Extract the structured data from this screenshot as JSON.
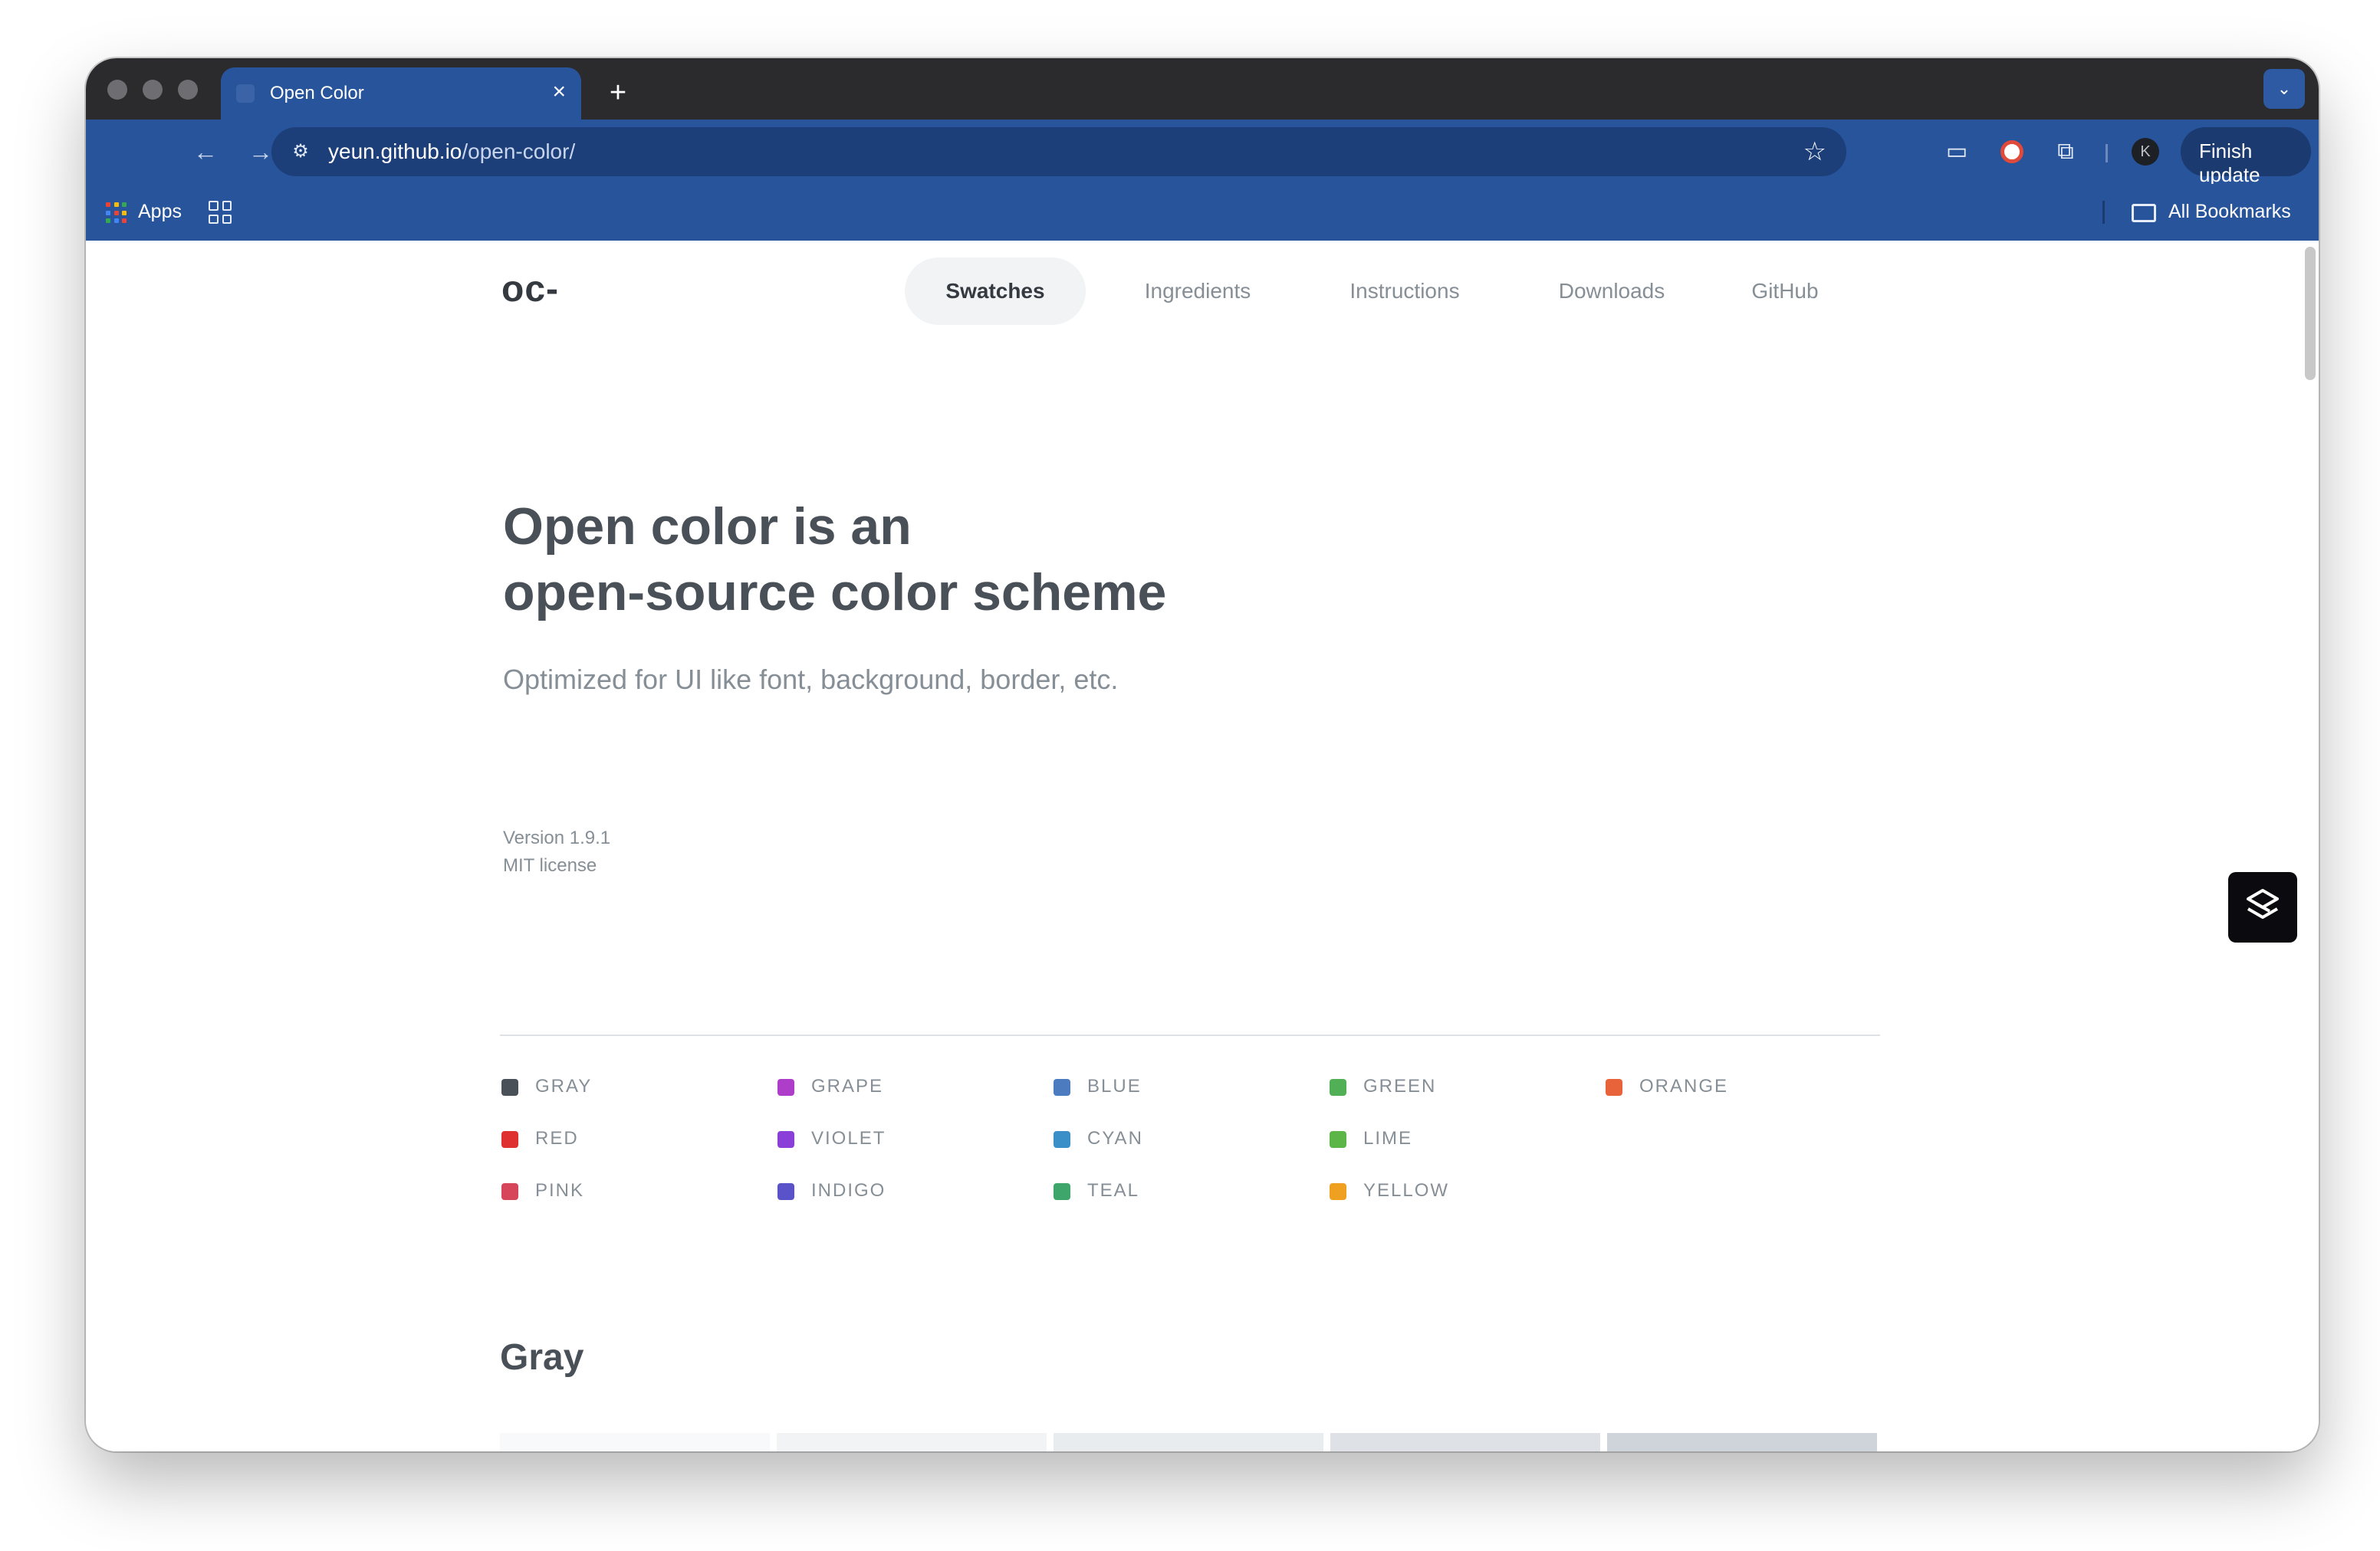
{
  "browser": {
    "tab_title": "Open Color",
    "url_domain": "yeun.github.io",
    "url_path": "/open-color/",
    "finish_update": "Finish update",
    "bookmarks_apps": "Apps",
    "all_bookmarks": "All Bookmarks",
    "profile_initial": "K"
  },
  "site": {
    "logo": "oc-",
    "nav": [
      "Swatches",
      "Ingredients",
      "Instructions",
      "Downloads",
      "GitHub"
    ],
    "active_nav": "Swatches"
  },
  "hero": {
    "title_line1": "Open color is an",
    "title_line2": "open-source color scheme",
    "subtitle": "Optimized for UI like font, background, border, etc.",
    "version": "Version 1.9.1",
    "license": "MIT license"
  },
  "legend": [
    {
      "label": "GRAY",
      "color": "#495057"
    },
    {
      "label": "GRAPE",
      "color": "#ae3ec9"
    },
    {
      "label": "BLUE",
      "color": "#4c7bc0"
    },
    {
      "label": "GREEN",
      "color": "#51b055"
    },
    {
      "label": "ORANGE",
      "color": "#e8633a"
    },
    {
      "label": "RED",
      "color": "#e03131"
    },
    {
      "label": "VIOLET",
      "color": "#8b3fd9"
    },
    {
      "label": "CYAN",
      "color": "#3b8fc9"
    },
    {
      "label": "LIME",
      "color": "#5cb547"
    },
    {
      "label": "PINK",
      "color": "#d6455a"
    },
    {
      "label": "INDIGO",
      "color": "#5a52c9"
    },
    {
      "label": "TEAL",
      "color": "#3fa66b"
    },
    {
      "label": "YELLOW",
      "color": "#f0a020"
    }
  ],
  "section": {
    "title": "Gray",
    "swatches": [
      "#f8f9fa",
      "#f1f3f5",
      "#e9ecef",
      "#dee2e6",
      "#ced4da"
    ]
  },
  "icons": {
    "back": "arrow-left-icon",
    "forward": "arrow-right-icon",
    "reload": "reload-icon",
    "site_settings": "tune-icon",
    "star": "star-icon",
    "extensions": "puzzle-icon",
    "floating": "stack-logo-icon"
  }
}
